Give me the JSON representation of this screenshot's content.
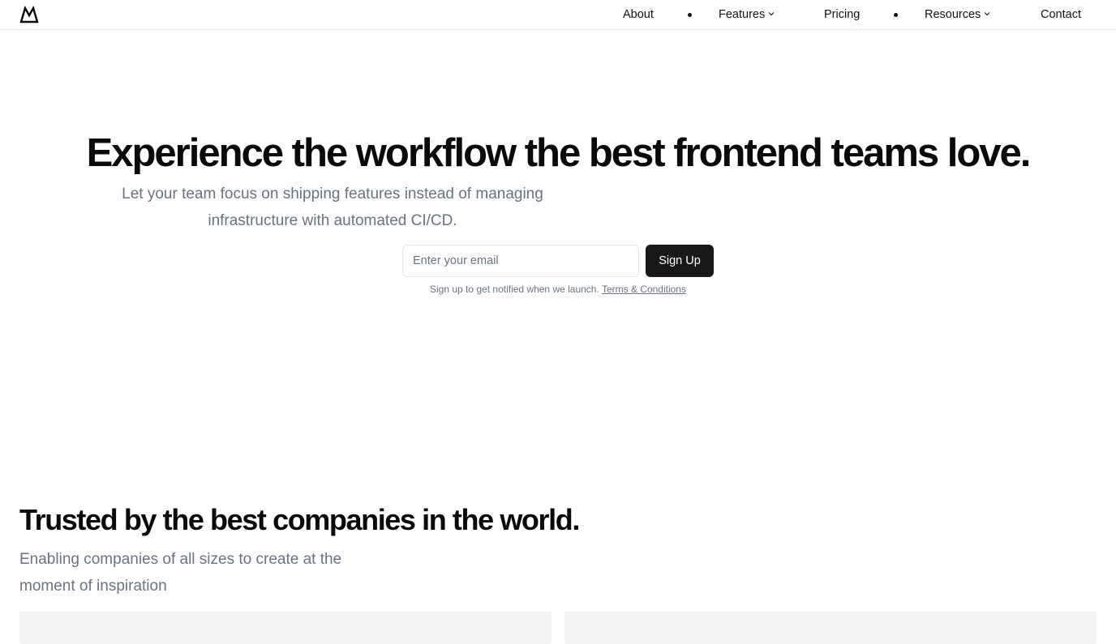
{
  "header": {
    "logo_icon": "mountain-logo-icon",
    "nav": {
      "about": "About",
      "features": "Features",
      "pricing": "Pricing",
      "resources": "Resources",
      "contact": "Contact"
    }
  },
  "hero": {
    "title": "Experience the workflow the best frontend teams love.",
    "subtitle": "Let your team focus on shipping features instead of managing infrastructure with automated CI/CD.",
    "email_placeholder": "Enter your email",
    "signup_label": "Sign Up",
    "note": "Sign up to get notified when we launch.",
    "terms_label": "Terms & Conditions"
  },
  "trusted": {
    "title": "Trusted by the best companies in the world.",
    "subtitle": "Enabling companies of all sizes to create at the moment of inspiration"
  },
  "colors": {
    "primary_button": "#18181b",
    "muted_text": "#6b7280",
    "border": "#e5e7eb",
    "card_bg": "#f3f4f6"
  }
}
